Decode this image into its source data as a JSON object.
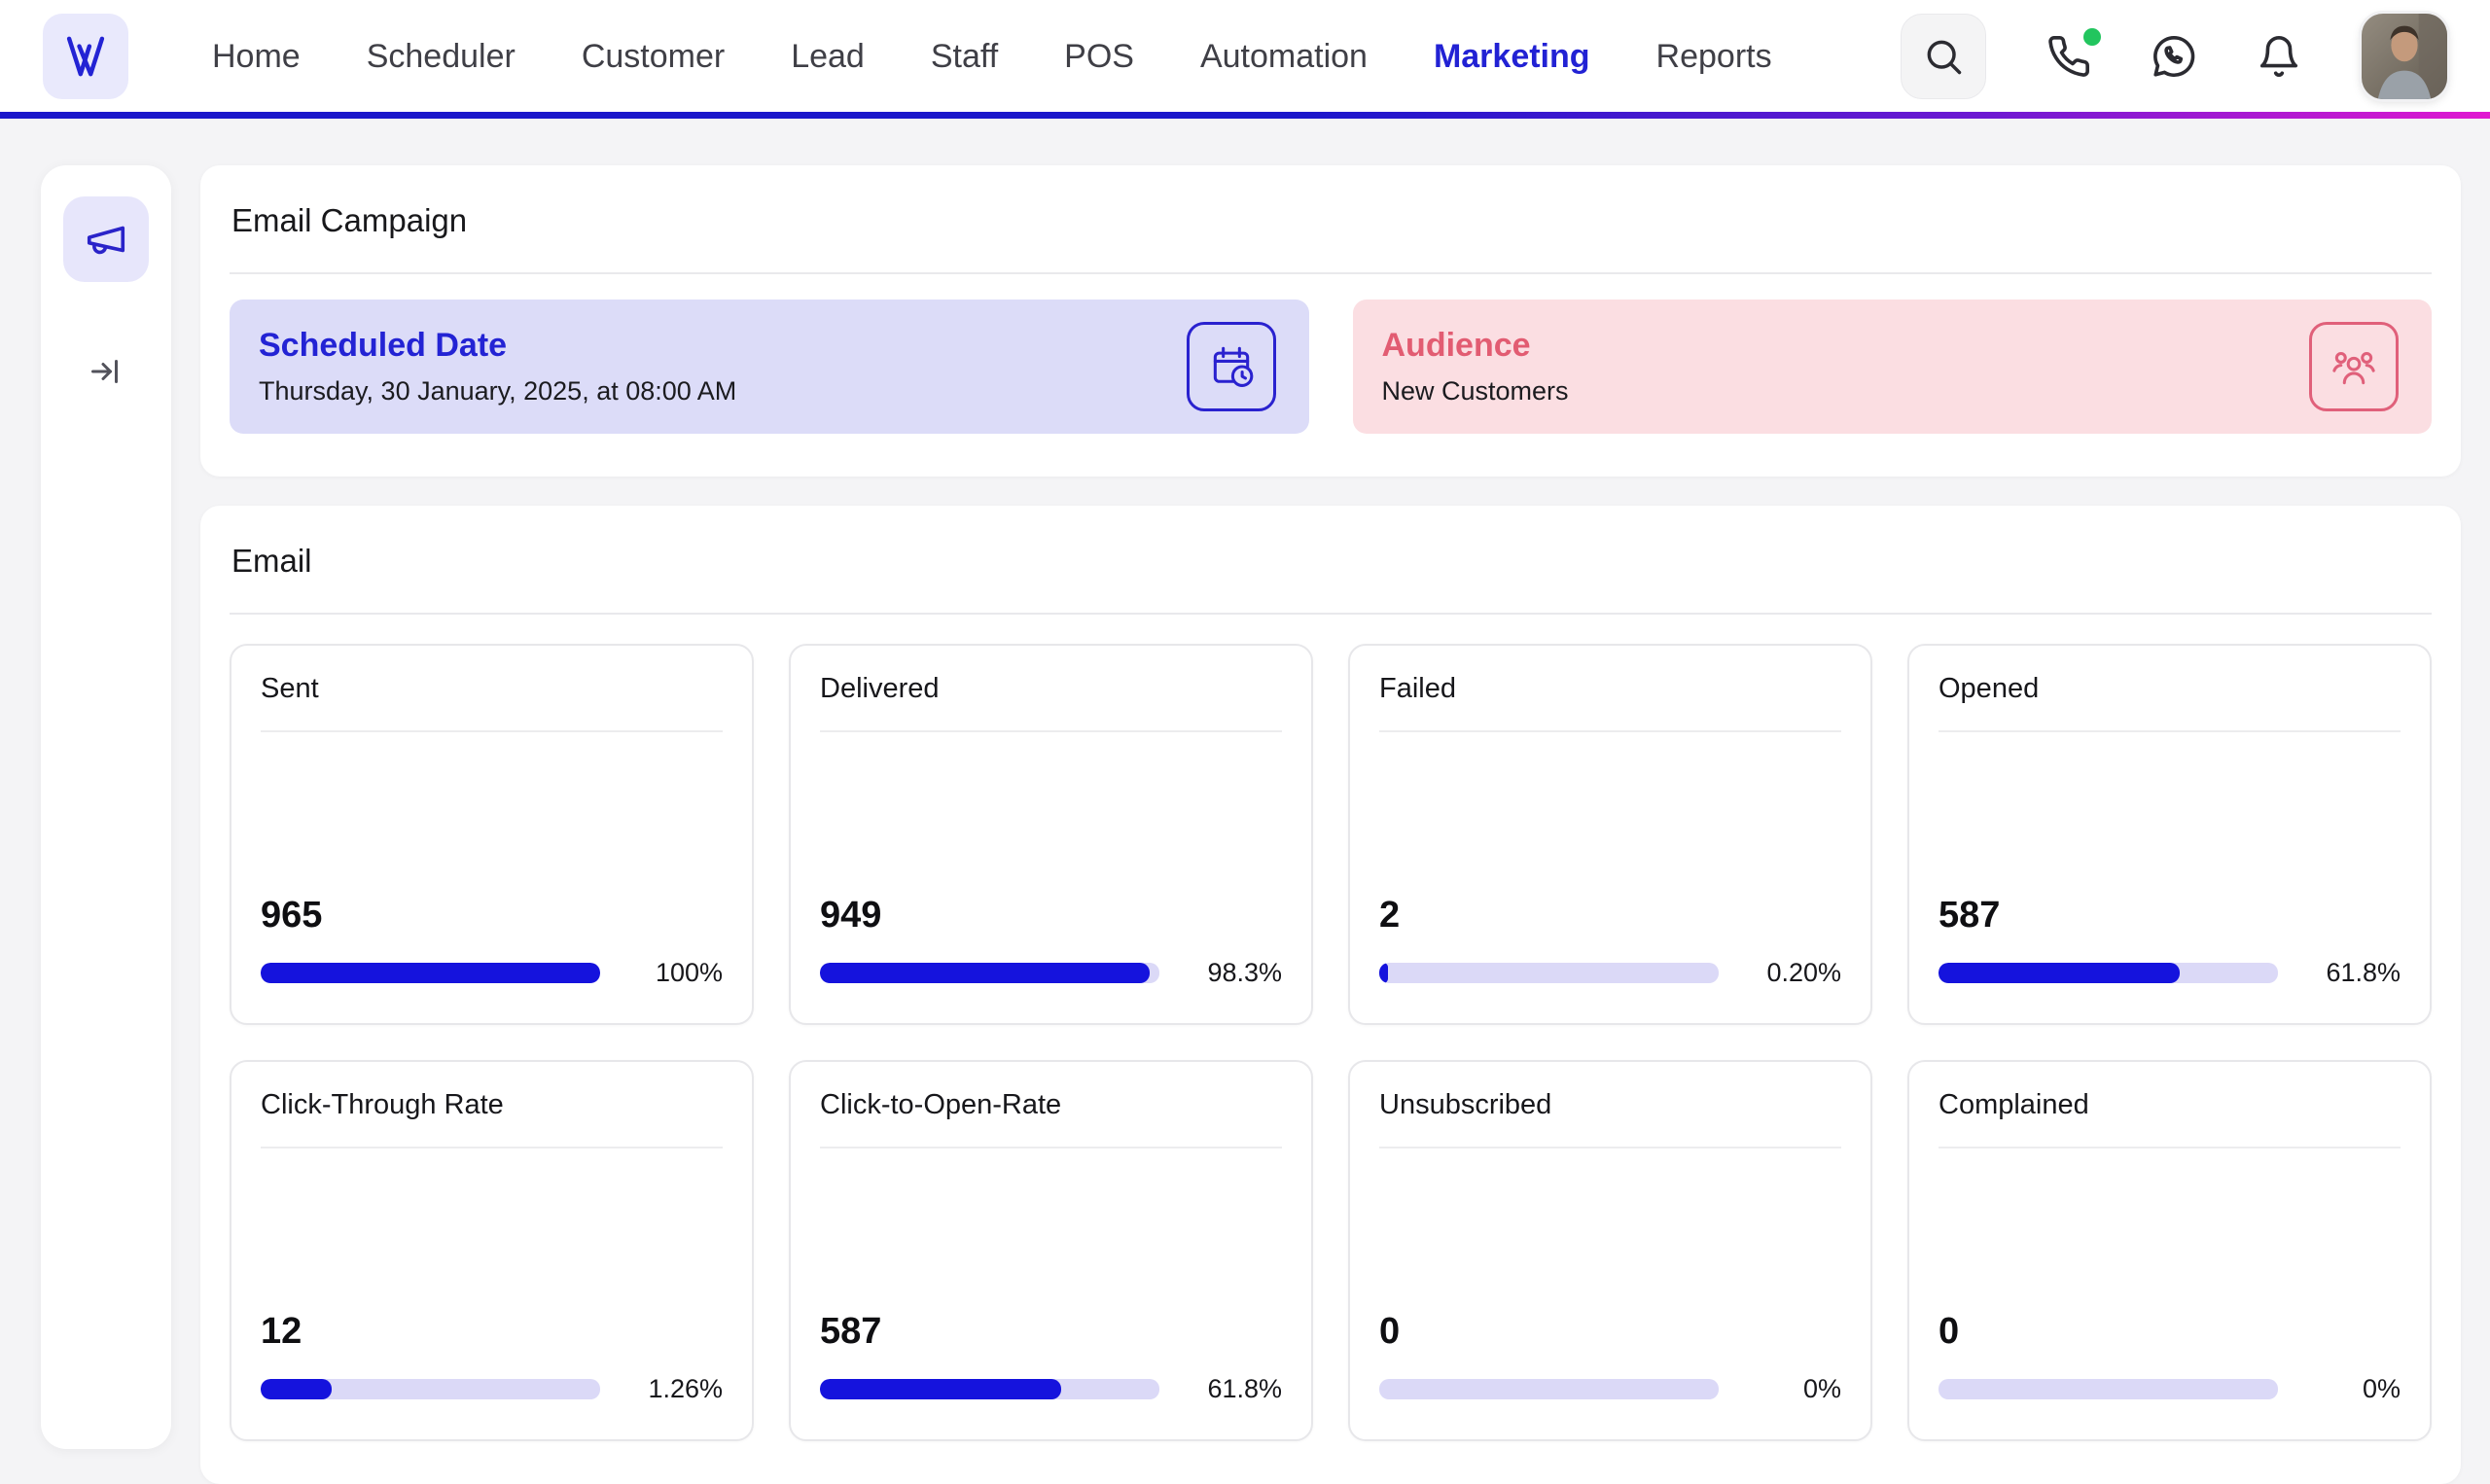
{
  "nav": {
    "logo": {
      "text": "W",
      "icon": "w-logo"
    },
    "items": [
      {
        "label": "Home",
        "active": false
      },
      {
        "label": "Scheduler",
        "active": false
      },
      {
        "label": "Customer",
        "active": false
      },
      {
        "label": "Lead",
        "active": false
      },
      {
        "label": "Staff",
        "active": false
      },
      {
        "label": "POS",
        "active": false
      },
      {
        "label": "Automation",
        "active": false
      },
      {
        "label": "Marketing",
        "active": true
      },
      {
        "label": "Reports",
        "active": false
      }
    ],
    "actions": {
      "search_icon": "magnifier",
      "phone_icon": "phone-handset",
      "phone_status": "online-green-dot",
      "whatsapp_icon": "whatsapp",
      "notifications_icon": "bell",
      "avatar": "user-photo"
    }
  },
  "sidebar": {
    "items": [
      {
        "icon": "megaphone",
        "active": true
      },
      {
        "icon": "arrow-to-right-collapse",
        "active": false
      }
    ]
  },
  "campaign": {
    "section_title": "Email Campaign",
    "cards": [
      {
        "title": "Scheduled Date",
        "value": "Thursday, 30 January, 2025, at 08:00 AM",
        "icon": "calendar-clock",
        "theme": "blue"
      },
      {
        "title": "Audience",
        "value": "New Customers",
        "icon": "users-group",
        "theme": "rose"
      }
    ]
  },
  "email": {
    "section_title": "Email",
    "metrics": [
      {
        "label": "Sent",
        "value": "965",
        "percent": "100%",
        "fill": 100
      },
      {
        "label": "Delivered",
        "value": "949",
        "percent": "98.3%",
        "fill": 97
      },
      {
        "label": "Failed",
        "value": "2",
        "percent": "0.20%",
        "fill": 2.5
      },
      {
        "label": "Opened",
        "value": "587",
        "percent": "61.8%",
        "fill": 71
      },
      {
        "label": "Click-Through Rate",
        "value": "12",
        "percent": "1.26%",
        "fill": 21
      },
      {
        "label": "Click-to-Open-Rate",
        "value": "587",
        "percent": "61.8%",
        "fill": 71
      },
      {
        "label": "Unsubscribed",
        "value": "0",
        "percent": "0%",
        "fill": 0
      },
      {
        "label": "Complained",
        "value": "0",
        "percent": "0%",
        "fill": 0
      }
    ]
  },
  "colors": {
    "accent": "#2222d4",
    "bar_fill": "#1513dd",
    "bar_track": "#dbd9f7",
    "lavender_card": "#dcdcf8",
    "rose_card": "#fbdee2",
    "rose_text": "#e25c72",
    "nav_gradient_start": "#1b17cb",
    "nav_gradient_end": "#e118d1",
    "online_dot": "#22c55e"
  }
}
